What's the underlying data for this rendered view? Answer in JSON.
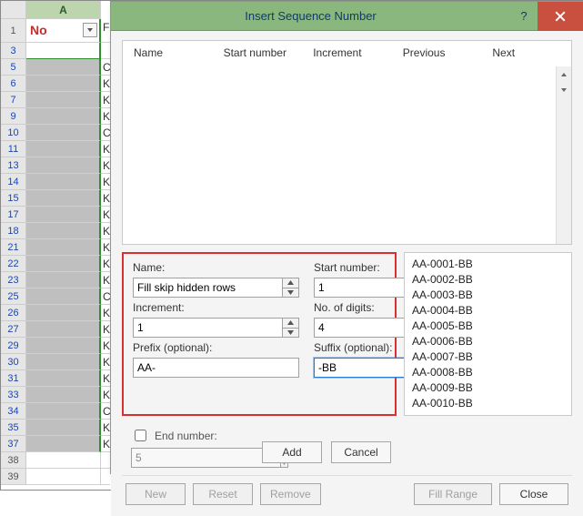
{
  "sheet": {
    "col_label": "A",
    "header_cell": "No",
    "rows": [
      {
        "n": "1",
        "type": "header"
      },
      {
        "n": "3",
        "type": "white",
        "b": ""
      },
      {
        "n": "5",
        "b": "C"
      },
      {
        "n": "6",
        "b": "K"
      },
      {
        "n": "7",
        "b": "K"
      },
      {
        "n": "9",
        "b": "K"
      },
      {
        "n": "10",
        "b": "C"
      },
      {
        "n": "11",
        "b": "K"
      },
      {
        "n": "13",
        "b": "K"
      },
      {
        "n": "14",
        "b": "K"
      },
      {
        "n": "15",
        "b": "K"
      },
      {
        "n": "17",
        "b": "K"
      },
      {
        "n": "18",
        "b": "K"
      },
      {
        "n": "21",
        "b": "K"
      },
      {
        "n": "22",
        "b": "K"
      },
      {
        "n": "23",
        "b": "K"
      },
      {
        "n": "25",
        "b": "C"
      },
      {
        "n": "26",
        "b": "K"
      },
      {
        "n": "27",
        "b": "K"
      },
      {
        "n": "29",
        "b": "K"
      },
      {
        "n": "30",
        "b": "K"
      },
      {
        "n": "31",
        "b": "K"
      },
      {
        "n": "33",
        "b": "K"
      },
      {
        "n": "34",
        "b": "C"
      },
      {
        "n": "35",
        "b": "K"
      },
      {
        "n": "37",
        "b": "K"
      },
      {
        "n": "38",
        "plain": true
      },
      {
        "n": "39",
        "plain": true
      }
    ]
  },
  "dialog": {
    "title": "Insert Sequence Number",
    "help": "?",
    "columns": {
      "name": "Name",
      "start": "Start number",
      "inc": "Increment",
      "prev": "Previous",
      "next": "Next"
    },
    "form": {
      "name_label": "Name:",
      "name_value": "Fill skip hidden rows",
      "start_label": "Start number:",
      "start_value": "1",
      "inc_label": "Increment:",
      "inc_value": "1",
      "digits_label": "No. of digits:",
      "digits_value": "4",
      "prefix_label": "Prefix (optional):",
      "prefix_value": "AA-",
      "suffix_label": "Suffix (optional):",
      "suffix_value": "-BB",
      "end_label": "End number:",
      "end_value": "5"
    },
    "preview": [
      "AA-0001-BB",
      "AA-0002-BB",
      "AA-0003-BB",
      "AA-0004-BB",
      "AA-0005-BB",
      "AA-0006-BB",
      "AA-0007-BB",
      "AA-0008-BB",
      "AA-0009-BB",
      "AA-0010-BB"
    ],
    "buttons": {
      "add": "Add",
      "cancel": "Cancel",
      "new": "New",
      "reset": "Reset",
      "remove": "Remove",
      "fill": "Fill Range",
      "close": "Close"
    }
  }
}
